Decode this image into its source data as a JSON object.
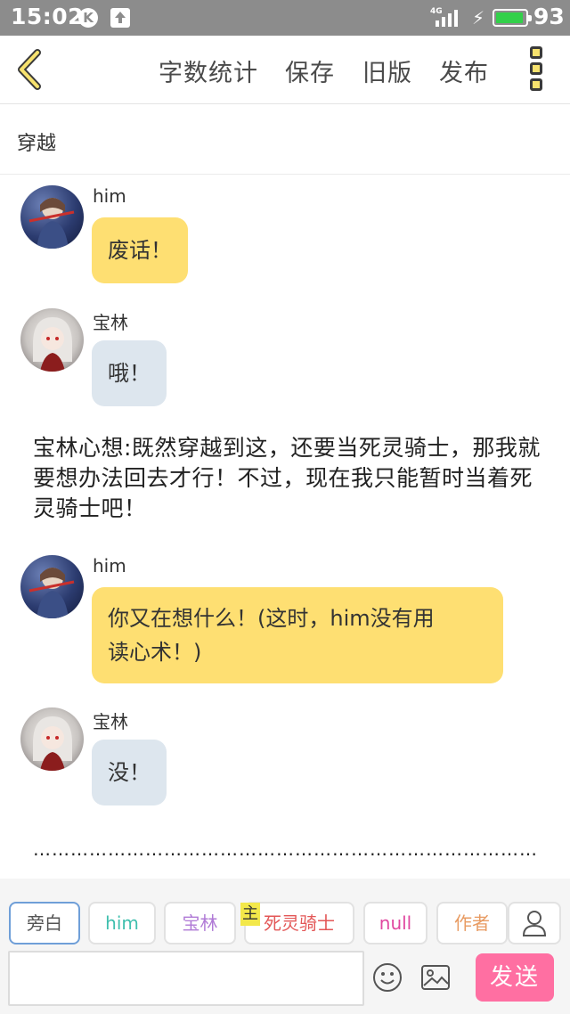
{
  "status_bar": {
    "time": "15:02",
    "k_icon": "K",
    "network": "4G",
    "battery_percent": "93",
    "battery_level": 0.93
  },
  "toolbar": {
    "word_count": "字数统计",
    "save": "保存",
    "old_version": "旧版",
    "publish": "发布"
  },
  "chapter_title": "穿越",
  "messages": [
    {
      "type": "dialogue",
      "speaker": "him",
      "text": "废话！",
      "style": "yellow"
    },
    {
      "type": "dialogue",
      "speaker": "宝林",
      "text": "哦！",
      "style": "gray"
    },
    {
      "type": "narration",
      "text": "宝林心想:既然穿越到这，还要当死灵骑士，那我就要想办法回去才行！不过，现在我只能暂时当着死灵骑士吧！"
    },
    {
      "type": "dialogue",
      "speaker": "him",
      "text_line1": "你又在想什么！(这时，him没有用",
      "text_line2": "读心术！)",
      "style": "yellow"
    },
    {
      "type": "dialogue",
      "speaker": "宝林",
      "text": "没！",
      "style": "gray"
    },
    {
      "type": "ellipsis",
      "text": "………………………………………………………………………"
    }
  ],
  "roles": {
    "narration": "旁白",
    "him": "him",
    "baolin": "宝林",
    "knight_tag": "主",
    "knight": "死灵骑士",
    "null": "null",
    "author": "作者"
  },
  "composer": {
    "input_value": "",
    "send": "发送"
  },
  "colors": {
    "accent_yellow": "#fedf72",
    "bubble_gray": "#dde6ee",
    "send_pink": "#ff6fa2",
    "narration_border": "#6f9fd8"
  },
  "icons": [
    "back-icon",
    "more-icon",
    "emoji-icon",
    "image-icon",
    "add-role-icon",
    "upload-icon",
    "signal-icon",
    "bolt-icon",
    "battery-icon"
  ]
}
